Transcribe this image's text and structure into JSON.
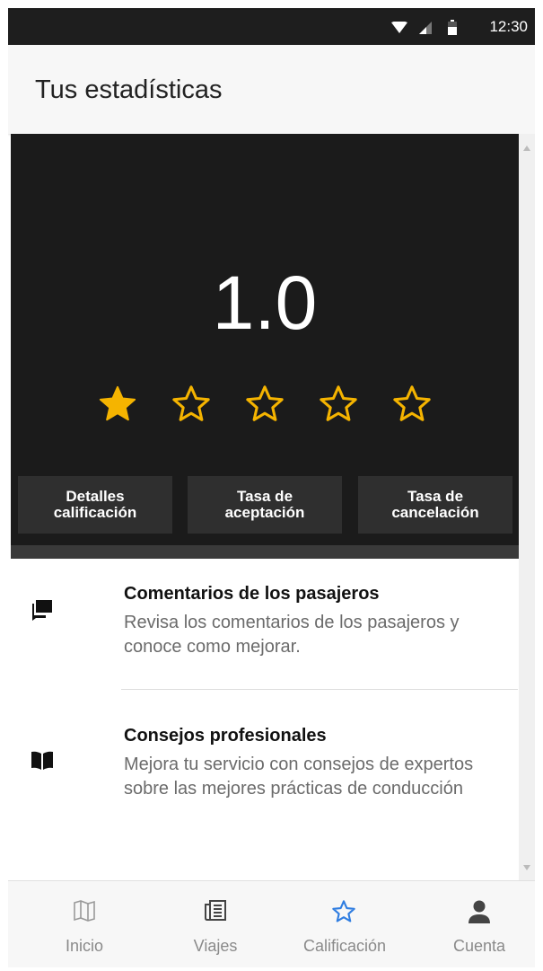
{
  "status_bar": {
    "time": "12:30"
  },
  "app_bar": {
    "title": "Tus estadísticas"
  },
  "rating": {
    "score": "1.0",
    "stars_filled": 1,
    "stars_total": 5,
    "star_color": "#f5b400"
  },
  "stat_buttons": [
    {
      "label": "Detalles\ncalificación"
    },
    {
      "label": "Tasa de\naceptación"
    },
    {
      "label": "Tasa de\ncancelación"
    }
  ],
  "list": [
    {
      "title": "Comentarios de los pasajeros",
      "description": "Revisa los comentarios de los pasajeros y conoce como mejorar.",
      "icon": "chat-bubbles-icon"
    },
    {
      "title": "Consejos profesionales",
      "description": "Mejora tu servicio con consejos de expertos sobre las mejores prácticas de conducción",
      "icon": "book-icon"
    }
  ],
  "bottom_nav": {
    "tabs": [
      {
        "label": "Inicio",
        "icon": "map-icon"
      },
      {
        "label": "Viajes",
        "icon": "newspaper-icon"
      },
      {
        "label": "Calificación",
        "icon": "star-outline-icon",
        "active": true
      },
      {
        "label": "Cuenta",
        "icon": "person-icon"
      }
    ],
    "active_color": "#2f7de1"
  }
}
